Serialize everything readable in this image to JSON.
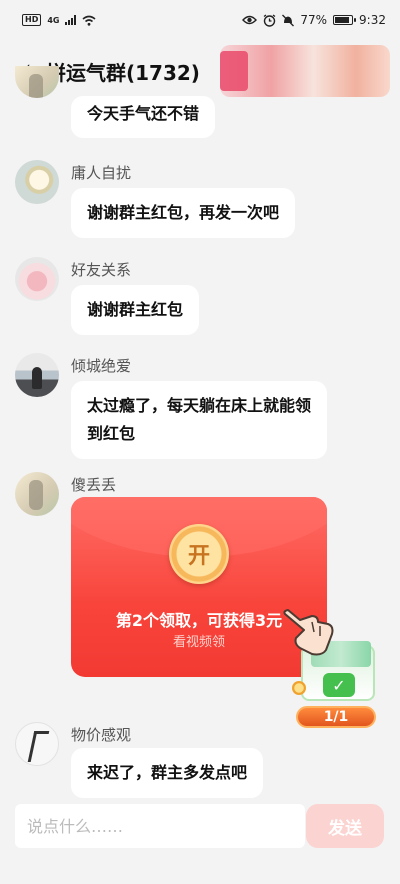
{
  "status_bar": {
    "hd": "HD",
    "network": "4G",
    "battery_percent": "77%",
    "battery_level": 0.77,
    "time": "9:32",
    "icons": [
      "signal-icon",
      "wifi-icon",
      "eye-icon",
      "alarm-icon",
      "mute-icon",
      "battery-icon"
    ]
  },
  "header": {
    "back_icon": "chevron-left-icon",
    "title": "拼运气群(1732)"
  },
  "messages": [
    {
      "name": "",
      "text": "今天手气还不错"
    },
    {
      "name": "庸人自扰",
      "text": "谢谢群主红包，再发一次吧"
    },
    {
      "name": "好友关系",
      "text": "谢谢群主红包"
    },
    {
      "name": "倾城绝爱",
      "text": "太过瘾了，每天躺在床上就能领到红包"
    },
    {
      "name": "傻丢丢",
      "type": "red-packet"
    },
    {
      "name": "物价感观",
      "text": "来迟了，群主多发点吧"
    }
  ],
  "red_packet": {
    "open_label": "开",
    "main_text": "第2个领取，可获得3元",
    "sub_text": "看视频领"
  },
  "reward_widget": {
    "counter": "1/1"
  },
  "input": {
    "placeholder": "说点什么……",
    "value": "",
    "send_label": "发送"
  },
  "colors": {
    "accent": "#f23a33",
    "send_button": "#fbd3d0",
    "background": "#f3f3f3"
  }
}
